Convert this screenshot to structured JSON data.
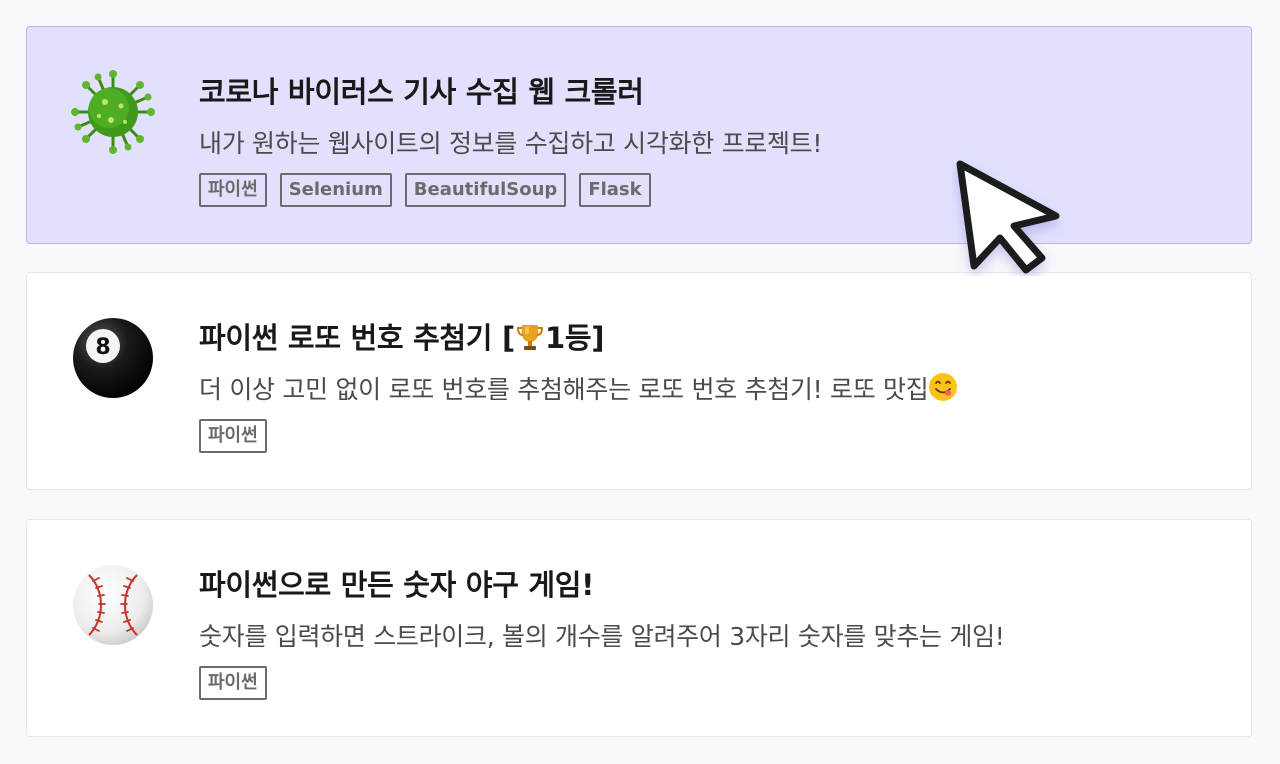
{
  "projects": [
    {
      "icon": "virus-icon",
      "title": "코로나 바이러스 기사 수집 웹 크롤러",
      "description": "내가 원하는 웹사이트의 정보를 수집하고 시각화한 프로젝트!",
      "tags": [
        "파이썬",
        "Selenium",
        "BeautifulSoup",
        "Flask"
      ]
    },
    {
      "icon": "eight-ball-icon",
      "title_prefix": "파이썬 로또 번호 추첨기 [",
      "title_suffix": "1등]",
      "title_inline_icon": "trophy-icon",
      "description": "더 이상 고민 없이 로또 번호를 추첨해주는 로또 번호 추첨기! 로또 맛집",
      "description_inline_icon": "yum-face-icon",
      "tags": [
        "파이썬"
      ]
    },
    {
      "icon": "baseball-icon",
      "title": "파이썬으로 만든 숫자 야구 게임!",
      "description": "숫자를 입력하면 스트라이크, 볼의 개수를 알려주어 3자리 숫자를 맞추는 게임!",
      "tags": [
        "파이썬"
      ]
    }
  ],
  "cursor_icon": "mouse-pointer-icon",
  "colors": {
    "page_background": "#f8f9fb",
    "hover_card_background": "#e1e1fe",
    "hover_card_border": "#b7b6ee",
    "tag_color": "#6b6b6b"
  }
}
